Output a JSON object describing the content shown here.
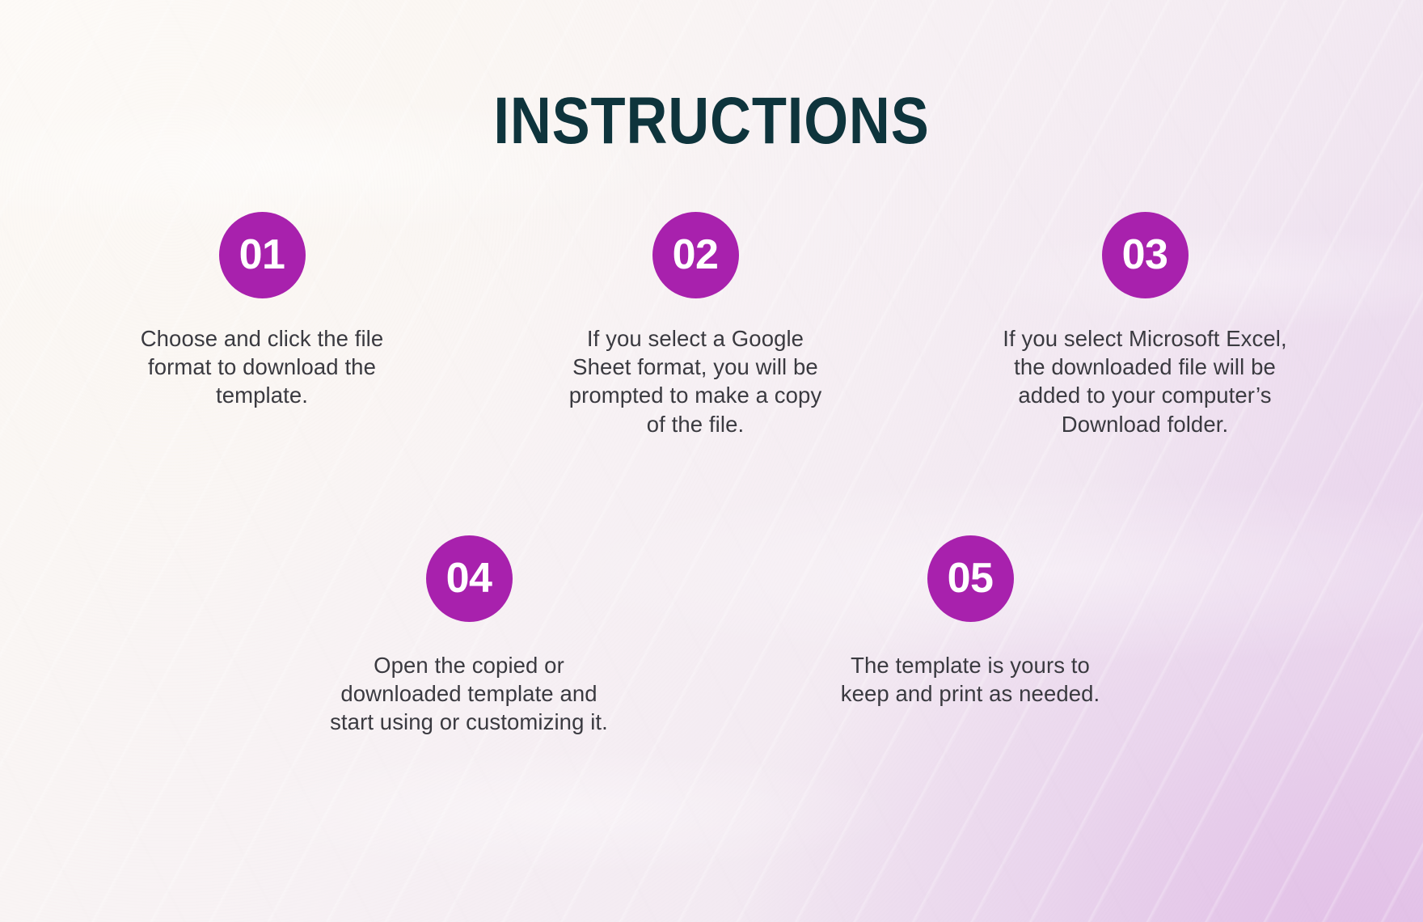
{
  "page": {
    "title": "INSTRUCTIONS"
  },
  "theme": {
    "accent": "#A821AD",
    "title_color": "#0E343C",
    "body_color": "#3A3A40",
    "badge_text_color": "#FFFFFF",
    "background_start": "#FCF9F6",
    "background_end": "#E4D0E8"
  },
  "steps": [
    {
      "number": "01",
      "text": "Choose and click the file\nformat to download the\ntemplate."
    },
    {
      "number": "02",
      "text": "If you select a Google\nSheet format, you will be\nprompted to make a copy\nof the file."
    },
    {
      "number": "03",
      "text": "If you select Microsoft Excel,\nthe downloaded file will be\nadded to your computer’s\nDownload  folder."
    },
    {
      "number": "04",
      "text": "Open the copied or\ndownloaded template and\nstart using or customizing it."
    },
    {
      "number": "05",
      "text": "The template is yours to\nkeep and print as needed."
    }
  ]
}
